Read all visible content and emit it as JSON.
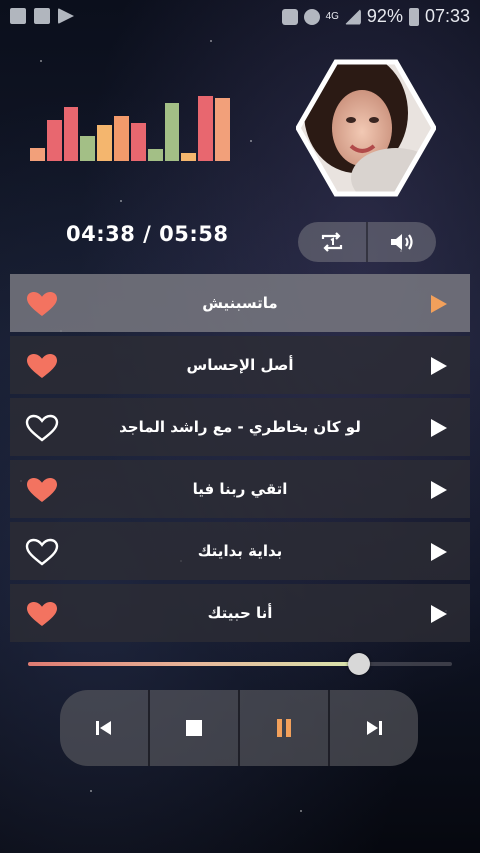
{
  "status_bar": {
    "left_icons": [
      "image-icon",
      "gallery-icon",
      "play-store-icon"
    ],
    "right_icons": [
      "mute-icon",
      "alarm-icon",
      "network-4g-icon",
      "signal-icon"
    ],
    "network_label": "4G",
    "battery": "92%",
    "time": "07:33"
  },
  "equalizer": {
    "levels": [
      0.2,
      0.62,
      0.82,
      0.38,
      0.55,
      0.68,
      0.58,
      0.18,
      0.88,
      0.12,
      0.98,
      0.95
    ],
    "colors": [
      "#f2a07a",
      "#e8676f",
      "#e8676f",
      "#a3bf86",
      "#f4b66e",
      "#f29a6b",
      "#e8676f",
      "#a3bf86",
      "#a3bf86",
      "#f4b66e",
      "#e8676f",
      "#f2a07a"
    ]
  },
  "player": {
    "time_text": "04:38 / 05:58",
    "progress": 0.78,
    "repeat_icon": "repeat-one-icon",
    "volume_icon": "volume-icon"
  },
  "songs": [
    {
      "title": "ماتسبنيش",
      "favorite": true,
      "active": true
    },
    {
      "title": "أصل الإحساس",
      "favorite": true,
      "active": false
    },
    {
      "title": "لو كان بخاطري - مع راشد الماجد",
      "favorite": false,
      "active": false
    },
    {
      "title": "اتقي ربنا فيا",
      "favorite": true,
      "active": false
    },
    {
      "title": "بداية بدايتك",
      "favorite": false,
      "active": false
    },
    {
      "title": "أنا حبيتك",
      "favorite": true,
      "active": false
    }
  ],
  "transport": {
    "buttons": [
      "previous-icon",
      "stop-icon",
      "pause-icon",
      "next-icon"
    ]
  },
  "colors": {
    "accent": "#f2a05b",
    "heart": "#f37360",
    "active_row": "#78787f"
  }
}
